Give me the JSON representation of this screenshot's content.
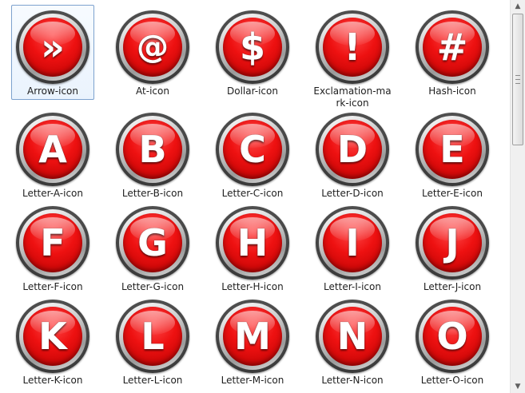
{
  "files": [
    {
      "label": "Arrow-icon",
      "glyph": "»",
      "selected": true
    },
    {
      "label": "At-icon",
      "glyph": "@"
    },
    {
      "label": "Dollar-icon",
      "glyph": "$"
    },
    {
      "label": "Exclamation-mark-icon",
      "glyph": "!"
    },
    {
      "label": "Hash-icon",
      "glyph": "#"
    },
    {
      "label": "Letter-A-icon",
      "glyph": "A"
    },
    {
      "label": "Letter-B-icon",
      "glyph": "B"
    },
    {
      "label": "Letter-C-icon",
      "glyph": "C"
    },
    {
      "label": "Letter-D-icon",
      "glyph": "D"
    },
    {
      "label": "Letter-E-icon",
      "glyph": "E"
    },
    {
      "label": "Letter-F-icon",
      "glyph": "F"
    },
    {
      "label": "Letter-G-icon",
      "glyph": "G"
    },
    {
      "label": "Letter-H-icon",
      "glyph": "H"
    },
    {
      "label": "Letter-I-icon",
      "glyph": "I"
    },
    {
      "label": "Letter-J-icon",
      "glyph": "J"
    },
    {
      "label": "Letter-K-icon",
      "glyph": "K"
    },
    {
      "label": "Letter-L-icon",
      "glyph": "L"
    },
    {
      "label": "Letter-M-icon",
      "glyph": "M"
    },
    {
      "label": "Letter-N-icon",
      "glyph": "N"
    },
    {
      "label": "Letter-O-icon",
      "glyph": "O"
    }
  ],
  "scrollbar": {
    "up_arrow": "▲",
    "down_arrow": "▼"
  },
  "colors": {
    "badge_red": "#ee1111",
    "selection_border": "#7da2ce",
    "selection_fill": "#eaf3fd"
  }
}
